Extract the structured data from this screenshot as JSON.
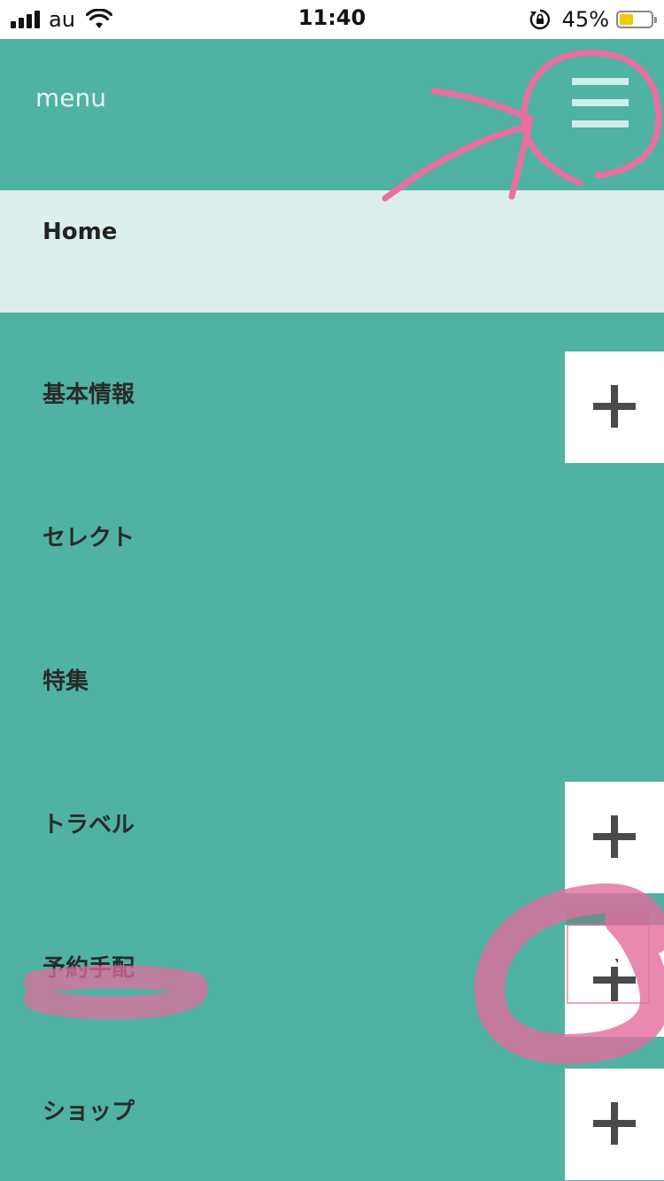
{
  "status_bar": {
    "carrier": "au",
    "time": "11:40",
    "battery_percent": "45%",
    "battery_level": 0.45,
    "icons": [
      "signal-icon",
      "wifi-icon",
      "rotation-lock-icon",
      "battery-icon"
    ]
  },
  "header": {
    "title": "menu",
    "menu_icon": "hamburger-icon"
  },
  "nav": {
    "home": "Home",
    "items": [
      {
        "label": "基本情報",
        "expandable": true
      },
      {
        "label": "セレクト",
        "expandable": false
      },
      {
        "label": "特集",
        "expandable": false
      },
      {
        "label": "トラベル",
        "expandable": true
      },
      {
        "label": "予約手配",
        "expandable": true
      },
      {
        "label": "ショップ",
        "expandable": true
      }
    ]
  },
  "colors": {
    "background": "#4fb2a2",
    "home_highlight": "#dbeeeb",
    "annotation": "#e8719f"
  }
}
